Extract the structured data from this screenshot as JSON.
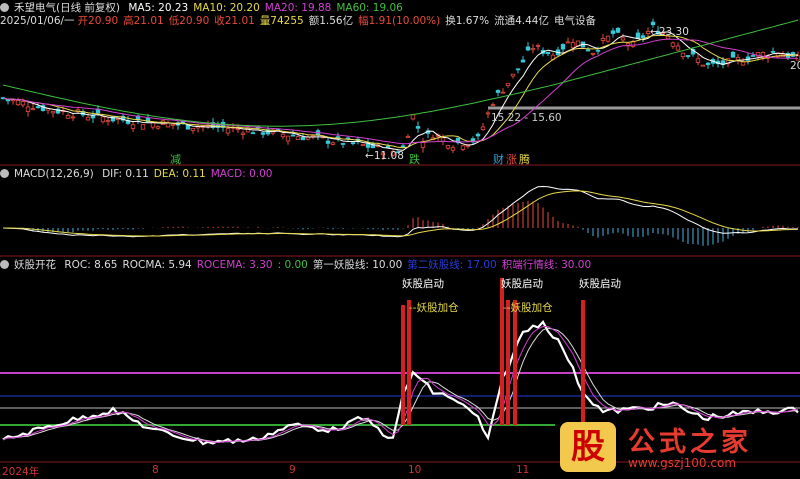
{
  "colors": {
    "bg": "#000000",
    "up": "#e84a3c",
    "down": "#38c9d8",
    "ma5": "#ffffff",
    "ma10": "#e8d94a",
    "ma20": "#d240d2",
    "ma60": "#3fbf3f",
    "accent_red": "#d42020",
    "purple_line": "#c640c6",
    "blue_line": "#2a3cd8",
    "green_line": "#33a633"
  },
  "price_panel": {
    "title": "禾望电气(日线 前复权)",
    "ma_labels": [
      {
        "text": "MA5: 20.23",
        "color": "#ffffff"
      },
      {
        "text": "MA10: 20.20",
        "color": "#e8d94a"
      },
      {
        "text": "MA20: 19.88",
        "color": "#d240d2"
      },
      {
        "text": "MA60: 19.06",
        "color": "#3fbf3f"
      }
    ],
    "quote_date": "2025/01/06/一",
    "quote": [
      {
        "text": "开20.90",
        "color": "#e84a3c"
      },
      {
        "text": "高21.01",
        "color": "#e84a3c"
      },
      {
        "text": "低20.90",
        "color": "#e84a3c"
      },
      {
        "text": "收21.01",
        "color": "#e84a3c"
      },
      {
        "text": "量74255",
        "color": "#e8d94a"
      },
      {
        "text": "额1.56亿",
        "color": "#dddddd"
      },
      {
        "text": "幅1.91(10.00%)",
        "color": "#e84a3c"
      },
      {
        "text": "换1.67%",
        "color": "#dddddd"
      },
      {
        "text": "流通4.44亿",
        "color": "#dddddd"
      },
      {
        "text": "电气设备",
        "color": "#dddddd"
      }
    ],
    "high_label": "23.30",
    "low_label": "11.08",
    "range_label": "15.22 - 15.60",
    "right_edge_label": "20",
    "tags": [
      {
        "text": "减",
        "color": "#3fbf3f"
      },
      {
        "text": "跌",
        "color": "#3fbf3f"
      },
      {
        "text": "财",
        "color": "#38a0e0"
      },
      {
        "text": "涨",
        "color": "#e84a3c"
      },
      {
        "text": "腾",
        "color": "#e8d94a"
      }
    ]
  },
  "macd_panel": {
    "title": "MACD(12,26,9)",
    "labels": [
      {
        "text": "DIF: 0.11",
        "color": "#dddddd"
      },
      {
        "text": "DEA: 0.11",
        "color": "#e8d94a"
      },
      {
        "text": "MACD: 0.00",
        "color": "#d240d2"
      }
    ]
  },
  "ind_panel": {
    "title": "妖股开花",
    "labels": [
      {
        "text": "ROC: 8.65",
        "color": "#dddddd"
      },
      {
        "text": "ROCMA: 5.94",
        "color": "#dddddd"
      },
      {
        "text": "ROCEMA: 3.30",
        "color": "#d240d2"
      },
      {
        "text": ": 0.00",
        "color": "#3fbf3f"
      },
      {
        "text": "第一妖股线: 10.00",
        "color": "#dddddd"
      },
      {
        "text": "第二妖股线: 17.00",
        "color": "#2a3cd8"
      },
      {
        "text": "积端行情线: 30.00",
        "color": "#d240d2"
      }
    ],
    "annotations": [
      {
        "text": "妖股启动",
        "color": "#ffffff"
      },
      {
        "text": "妖股启动",
        "color": "#ffffff"
      },
      {
        "text": "妖股启动",
        "color": "#ffffff"
      },
      {
        "text": "--妖股加仓",
        "color": "#e8d94a"
      },
      {
        "text": "--妖股加仓",
        "color": "#e8d94a"
      }
    ]
  },
  "x_axis": [
    "2024年",
    "8",
    "9",
    "10",
    "11"
  ],
  "watermark": {
    "seal": "股",
    "name": "公式之家",
    "url": "www.gszj100.com"
  }
}
